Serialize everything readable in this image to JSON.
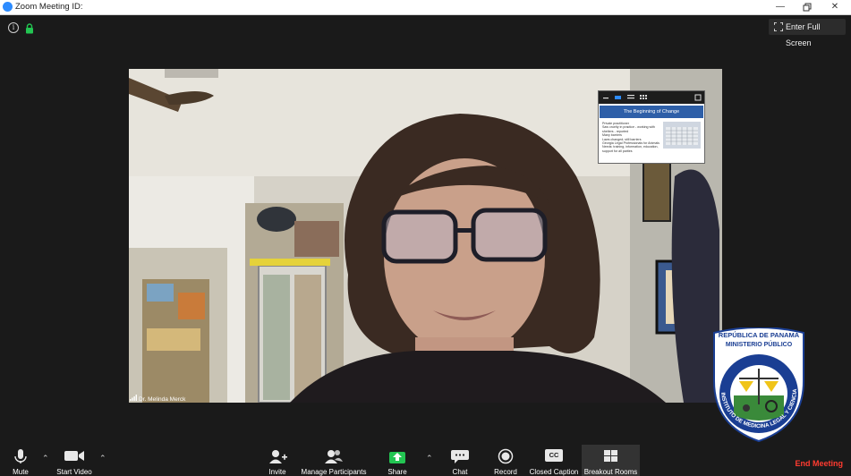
{
  "window": {
    "title": "Zoom Meeting ID:",
    "buttons": [
      "minimize",
      "restore",
      "close"
    ]
  },
  "top_bar": {
    "full_screen_label": "Enter Full Screen"
  },
  "video": {
    "participant_name": "Dr. Melinda Merck"
  },
  "shared_screen": {
    "slide_title": "The Beginning of Change",
    "bullets": [
      "Private practitioner",
      "Saw cruelty in practice - working with shelters - reported",
      "Many barriers",
      "Laws changed; still barriers",
      "Georgia Legal Professionals for Animals",
      "Needs: training, information, education, support for all parties"
    ]
  },
  "logo": {
    "top_line_1": "REPÚBLICA DE PANAMÁ",
    "top_line_2": "MINISTERIO PÚBLICO",
    "ring_text": "INSTITUTO DE MEDICINA LEGAL Y CIENCIAS FORENSES"
  },
  "controls": {
    "mute": "Mute",
    "start_video": "Start Video",
    "invite": "Invite",
    "manage_participants": "Manage Participants",
    "share": "Share",
    "chat": "Chat",
    "record": "Record",
    "closed_caption": "Closed Caption",
    "cc_badge": "CC",
    "breakout_rooms": "Breakout Rooms",
    "end_meeting": "End Meeting"
  },
  "colors": {
    "accent_share": "#23c552",
    "end_meeting": "#ff3b30",
    "zoom_blue": "#2d8cff",
    "lock_green": "#23c552"
  }
}
